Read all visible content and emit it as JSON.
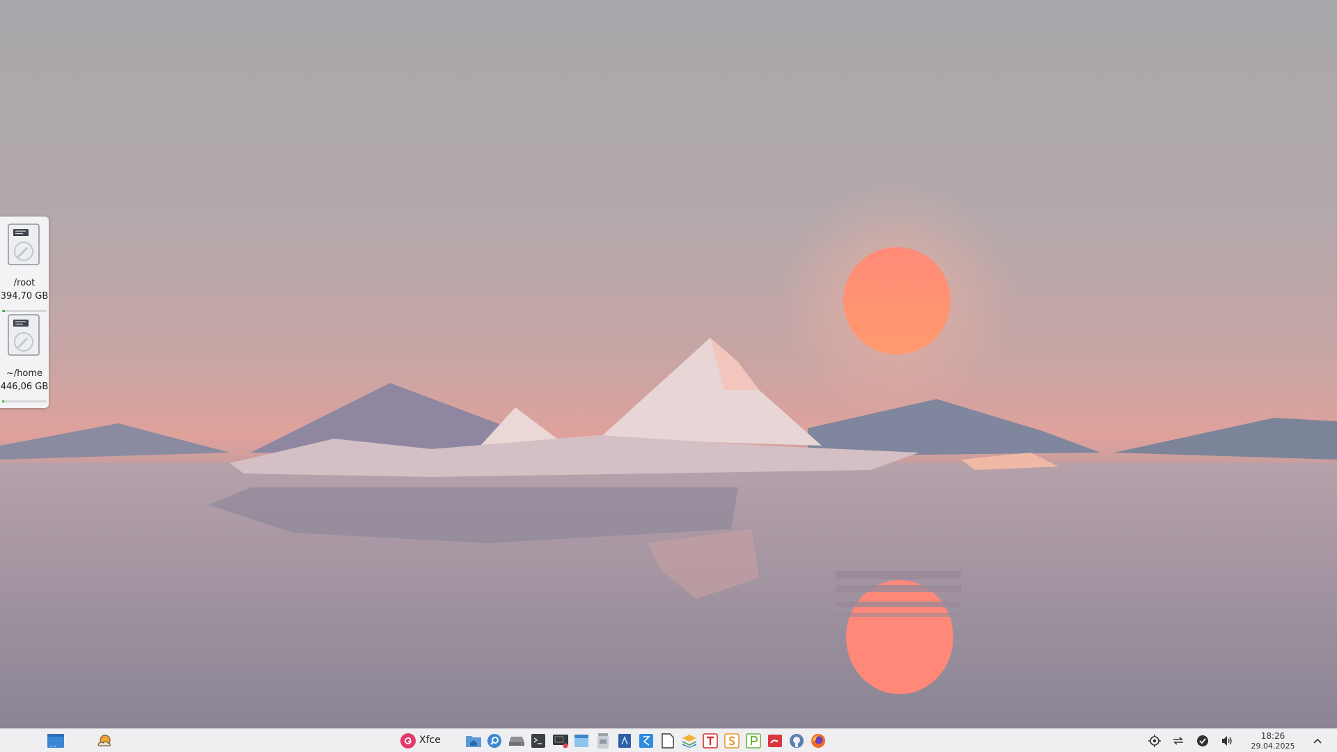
{
  "desktop": {
    "wallpaper": "low-poly sunset mountains and iceberg reflected in water",
    "drives": [
      {
        "label": "/root",
        "free": "394,70 GB",
        "usage": 0.07
      },
      {
        "label": "~/home",
        "free": "446,06 GB",
        "usage": 0.05
      }
    ]
  },
  "taskbar": {
    "menu_label": "Xfce",
    "clock": {
      "time": "18:26",
      "date": "29.04.2025"
    },
    "colors": {
      "background": "#efeef1",
      "accent": "#e13a6b"
    },
    "launchers": [
      {
        "name": "file-manager"
      },
      {
        "name": "app-finder"
      },
      {
        "name": "drive"
      },
      {
        "name": "terminal"
      },
      {
        "name": "screenshot"
      },
      {
        "name": "window-manager"
      },
      {
        "name": "archive"
      },
      {
        "name": "document-viewer"
      },
      {
        "name": "inkscape-like"
      },
      {
        "name": "text-editor"
      },
      {
        "name": "layers"
      },
      {
        "name": "text-t"
      },
      {
        "name": "text-s"
      },
      {
        "name": "text-p"
      },
      {
        "name": "presentation"
      },
      {
        "name": "github"
      },
      {
        "name": "firefox"
      }
    ]
  }
}
